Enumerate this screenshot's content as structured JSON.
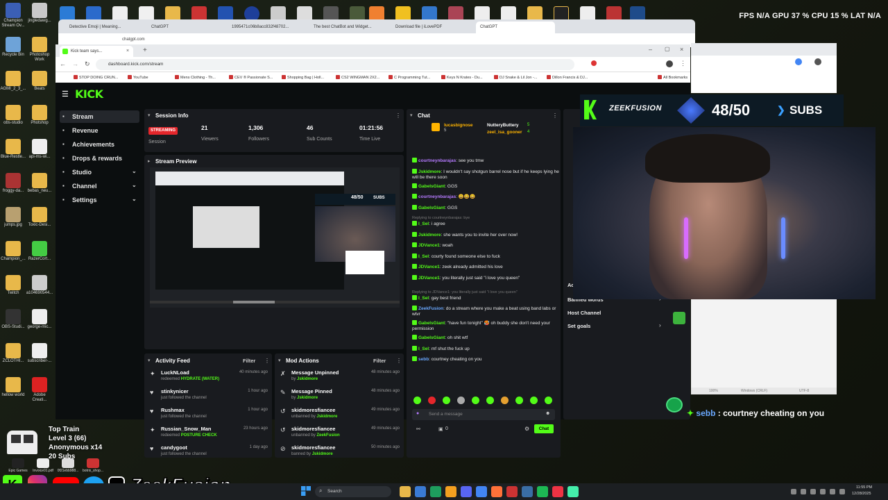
{
  "hud": {
    "fps_label": "FPS",
    "fps": "N/A",
    "gpu_label": "GPU",
    "gpu": "37 %",
    "cpu_label": "CPU",
    "cpu": "15 %",
    "lat_label": "LAT",
    "lat": "N/A"
  },
  "desktop_icons": [
    {
      "label": "Champion Stream Ov...",
      "color": "#3b5fb5"
    },
    {
      "label": "jingledawg...",
      "color": "#c9c9c9"
    },
    {
      "label": "Recycle Bin",
      "color": "#6ea3d8"
    },
    {
      "label": "Photoshop Work",
      "color": "#e8b84a"
    },
    {
      "label": "AGMI_2_3_...",
      "color": "#e8b84a"
    },
    {
      "label": "Beats",
      "color": "#e8b84a"
    },
    {
      "label": "obs-studio",
      "color": "#e8b84a"
    },
    {
      "label": "Photshop",
      "color": "#e8b84a"
    },
    {
      "label": "Blue-Restle...",
      "color": "#e8b84a"
    },
    {
      "label": "api-ms-wi...",
      "color": "#eeeeee"
    },
    {
      "label": "froggy-da...",
      "color": "#aa3333"
    },
    {
      "label": "bebas_neu...",
      "color": "#e8b84a"
    },
    {
      "label": "jumps.jpg",
      "color": "#b8a070"
    },
    {
      "label": "Toxic-Desi...",
      "color": "#e8b84a"
    },
    {
      "label": "Champion_...",
      "color": "#e8b84a"
    },
    {
      "label": "RazerCort...",
      "color": "#44cc44"
    },
    {
      "label": "Twitch",
      "color": "#e8b84a"
    },
    {
      "label": "a104690544...",
      "color": "#cccccc"
    },
    {
      "label": "OBS-Studi...",
      "color": "#333333"
    },
    {
      "label": "george-mic...",
      "color": "#eeeeee"
    },
    {
      "label": "ZCLOTHI...",
      "color": "#e8b84a"
    },
    {
      "label": "subscriber-...",
      "color": "#eeeeee"
    },
    {
      "label": "hellow world",
      "color": "#e8b84a"
    },
    {
      "label": "Adobe Creati...",
      "color": "#d22"
    }
  ],
  "chatgpt_tabs": [
    "Detective Emoji | Meaning...",
    "ChatGPT",
    "1995471c06b8acc832f48702...",
    "The best ChatBot and Widget...",
    "Download file | iLovePDF",
    "ChatGPT"
  ],
  "chatgpt_url": "chatgpt.com",
  "kick_tab": "Kick team says...",
  "kick_url": "dashboard.kick.com/stream",
  "bookmarks": [
    "STOP DOING CRUN...",
    "YouTube",
    "Mens Clothing - Th...",
    "CEV ® Passionate S...",
    "Shopping Bag | Holl...",
    "CS2 WINGMAN 2X2...",
    "C Programming Tut...",
    "Keys N Krates - Du...",
    "DJ Snake & Lil Jon -...",
    "Dillon Francis & DJ...",
    "All Bookmarks"
  ],
  "logo": "KICK",
  "sidebar": [
    {
      "label": "Stream",
      "icon": "stream-icon",
      "active": true
    },
    {
      "label": "Revenue",
      "icon": "revenue-icon"
    },
    {
      "label": "Achievements",
      "icon": "trophy-icon"
    },
    {
      "label": "Drops & rewards",
      "icon": "gift-icon"
    },
    {
      "label": "Studio",
      "icon": "studio-icon",
      "chevron": true
    },
    {
      "label": "Channel",
      "icon": "channel-icon",
      "chevron": true
    },
    {
      "label": "Settings",
      "icon": "gear-icon",
      "chevron": true
    }
  ],
  "session": {
    "title": "Session Info",
    "badge": "STREAMING",
    "badge_label": "Session",
    "stats": [
      {
        "value": "21",
        "label": "Viewers"
      },
      {
        "value": "1,306",
        "label": "Followers"
      },
      {
        "value": "46",
        "label": "Sub Counts"
      },
      {
        "value": "01:21:56",
        "label": "Time Live"
      }
    ]
  },
  "preview": {
    "title": "Stream Preview",
    "overlay_count": "48/50",
    "overlay_subs": "SUBS"
  },
  "activity": {
    "title": "Activity Feed",
    "filter": "Filter",
    "items": [
      {
        "name": "LuckNLoad",
        "sub_prefix": "redeemed",
        "sub_highlight": "HYDRATE (WATER)",
        "time": "40 minutes ago",
        "icon": "gift-icon"
      },
      {
        "name": "stinkynicer",
        "sub_prefix": "just followed the channel",
        "sub_highlight": "",
        "time": "1 hour ago",
        "icon": "heart-icon"
      },
      {
        "name": "Rushmax",
        "sub_prefix": "just followed the channel",
        "sub_highlight": "",
        "time": "1 hour ago",
        "icon": "heart-icon"
      },
      {
        "name": "Russian_Snow_Man",
        "sub_prefix": "redeemed",
        "sub_highlight": "POSTURE CHECK",
        "time": "23 hours ago",
        "icon": "gift-icon"
      },
      {
        "name": "candygoot",
        "sub_prefix": "just followed the channel",
        "sub_highlight": "",
        "time": "1 day ago",
        "icon": "heart-icon"
      }
    ]
  },
  "mod": {
    "title": "Mod Actions",
    "filter": "Filter",
    "items": [
      {
        "name": "Message Unpinned",
        "by": "by",
        "actor": "Jskidmore",
        "time": "48 minutes ago",
        "icon": "unpin-icon"
      },
      {
        "name": "Message Pinned",
        "by": "by",
        "actor": "Jskidmore",
        "time": "48 minutes ago",
        "icon": "pin-icon"
      },
      {
        "name": "skidmoresfiancee",
        "by": "unbanned by",
        "actor": "Jskidmore",
        "time": "49 minutes ago",
        "icon": "unban-icon"
      },
      {
        "name": "skidmoresfiancee",
        "by": "unbanned by",
        "actor": "ZeekFusion",
        "time": "49 minutes ago",
        "icon": "unban-icon"
      },
      {
        "name": "skidmoresfiancee",
        "by": "banned by",
        "actor": "Jskidmore",
        "time": "50 minutes ago",
        "icon": "ban-icon"
      }
    ]
  },
  "chat": {
    "title": "Chat",
    "pinned": [
      {
        "name": "lucasbignose",
        "count": "5"
      },
      {
        "name": "NutteryButtery",
        "count": "5"
      },
      {
        "name": "zeel_isa_gooner",
        "count": "4"
      }
    ],
    "lines": [
      {
        "user": "courtneynbarajas",
        "cls": "u-purple",
        "text": "see you tmw",
        "reply": ""
      },
      {
        "user": "Jskidmore",
        "cls": "u-green",
        "text": "I wouldn't say shotgun barrel nose but if he keeps lying he will be there soon",
        "reply": ""
      },
      {
        "user": "GabelsGiant",
        "cls": "u-green",
        "text": "GGS",
        "reply": ""
      },
      {
        "user": "courtneynbarajas",
        "cls": "u-purple",
        "text": "😀😀😀",
        "reply": ""
      },
      {
        "user": "GabelsGiant",
        "cls": "u-green",
        "text": "GGS",
        "reply": ""
      },
      {
        "user": "I_Sel",
        "cls": "u-green",
        "text": "i agree",
        "reply": "Replying to courtneynbarajas: bye"
      },
      {
        "user": "Jskidmore",
        "cls": "u-green",
        "text": "she wants you to invite her over now!",
        "reply": ""
      },
      {
        "user": "JDVance1",
        "cls": "u-green",
        "text": "woah",
        "reply": ""
      },
      {
        "user": "I_Sel",
        "cls": "u-green",
        "text": "courty found someone else to fuck",
        "reply": ""
      },
      {
        "user": "JDVance1",
        "cls": "u-green",
        "text": "zeek already admitted his love",
        "reply": ""
      },
      {
        "user": "JDVance1",
        "cls": "u-green",
        "text": "you literally just said \"i love you queen\"",
        "reply": ""
      },
      {
        "user": "I_Sel",
        "cls": "u-green",
        "text": "gay best friend",
        "reply": "Replying to JDVance1: you literally just said \"i love you queen\""
      },
      {
        "user": "ZeekFusion",
        "cls": "u-blue",
        "text": "do a stream where you make a beat using band labs or wtvr",
        "reply": ""
      },
      {
        "user": "GabelsGiant",
        "cls": "u-green",
        "text": "\"have fun tonight\" 🥵 oh buddy she don't need your permission",
        "reply": ""
      },
      {
        "user": "GabelsGiant",
        "cls": "u-green",
        "text": "oh shit wtf",
        "reply": ""
      },
      {
        "user": "I_Sel",
        "cls": "u-green",
        "text": "mf shut the fuck up",
        "reply": ""
      },
      {
        "user": "sebb",
        "cls": "u-blue",
        "text": "courtney cheating on you",
        "reply": ""
      }
    ],
    "placeholder": "Send a message",
    "send": "Chat",
    "points": "0"
  },
  "settings_panel": [
    {
      "label": "Account age restriction"
    },
    {
      "label": "Banned words"
    },
    {
      "label": "Host Channel"
    },
    {
      "label": "Set goals"
    }
  ],
  "overlay": {
    "brand": "ZEEKFUSION",
    "count": "48/50",
    "subs": "SUBS",
    "chat_user": "sebb",
    "chat_text": "courtney cheating on you"
  },
  "train": {
    "title": "Top Train",
    "level": "Level 3 (66)",
    "anon": "Anonymous x14",
    "subs": "20 Subs"
  },
  "socials": {
    "handle": "ZeekFusion"
  },
  "bottom_icons": [
    "Epic Games",
    "Invoice01.pdf",
    "0f21ebb988...",
    "botrix_shop..."
  ],
  "editor": {
    "status1": "100%",
    "status2": "Windows (CRLF)",
    "status3": "UTF-8"
  },
  "taskbar": {
    "search": "Search",
    "time": "11:55 PM",
    "date": "12/28/2025"
  },
  "colors": {
    "kick_green": "#53fc18",
    "panel": "#191b1f",
    "bg": "#0b0e0f",
    "streaming_red": "#e5262b"
  }
}
